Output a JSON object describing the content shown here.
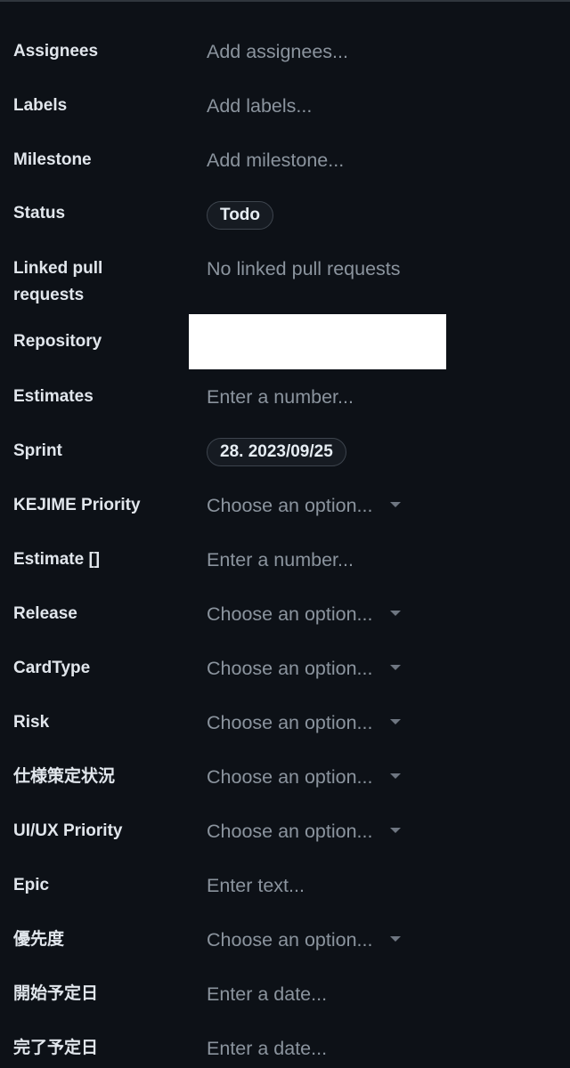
{
  "fields": {
    "assignees": {
      "label": "Assignees",
      "value": "Add assignees..."
    },
    "labels": {
      "label": "Labels",
      "value": "Add labels..."
    },
    "milestone": {
      "label": "Milestone",
      "value": "Add milestone..."
    },
    "status": {
      "label": "Status",
      "value": "Todo"
    },
    "linked_prs": {
      "label_line1": "Linked pull",
      "label_line2": "requests",
      "value": "No linked pull requests"
    },
    "repository": {
      "label": "Repository"
    },
    "estimates": {
      "label": "Estimates",
      "value": "Enter a number..."
    },
    "sprint": {
      "label": "Sprint",
      "value": "28. 2023/09/25"
    },
    "kejime_priority": {
      "label": "KEJIME Priority",
      "value": "Choose an option..."
    },
    "estimate_brackets": {
      "label": "Estimate []",
      "value": "Enter a number..."
    },
    "release": {
      "label": "Release",
      "value": "Choose an option..."
    },
    "card_type": {
      "label": "CardType",
      "value": "Choose an option..."
    },
    "risk": {
      "label": "Risk",
      "value": "Choose an option..."
    },
    "spec_status": {
      "label": "仕様策定状況",
      "value": "Choose an option..."
    },
    "uiux_priority": {
      "label": "UI/UX Priority",
      "value": "Choose an option..."
    },
    "epic": {
      "label": "Epic",
      "value": "Enter text..."
    },
    "priority_jp": {
      "label": "優先度",
      "value": "Choose an option..."
    },
    "start_date": {
      "label": "開始予定日",
      "value": "Enter a date..."
    },
    "end_date": {
      "label": "完了予定日",
      "value": "Enter a date..."
    }
  },
  "icons": {
    "dropdown": "caret-down-icon"
  },
  "colors": {
    "background": "#0d1117",
    "label_text": "#e1e6ec",
    "placeholder_text": "#8b949e",
    "chip_border": "#3d444d",
    "redaction": "#ffffff"
  }
}
